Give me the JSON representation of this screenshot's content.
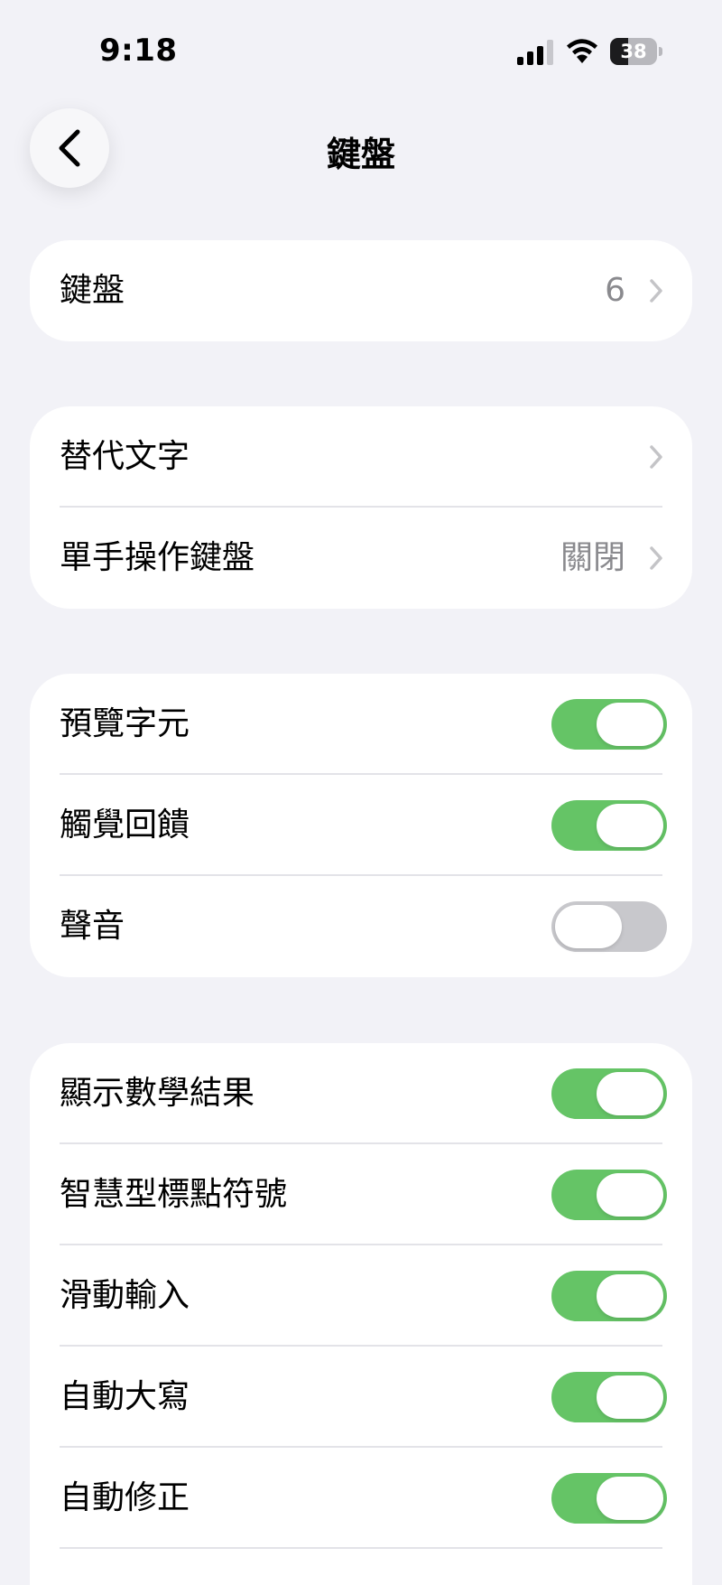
{
  "status_bar": {
    "time": "9:18",
    "battery": "38",
    "battery_level": 0.38
  },
  "nav": {
    "title": "鍵盤",
    "back_icon": "chevron-left-icon"
  },
  "group_keyboards": {
    "label": "鍵盤",
    "value": "6"
  },
  "group_text": {
    "items": [
      {
        "label": "替代文字",
        "value": ""
      },
      {
        "label": "單手操作鍵盤",
        "value": "關閉"
      }
    ]
  },
  "group_feedback": {
    "items": [
      {
        "label": "預覽字元",
        "on": true
      },
      {
        "label": "觸覺回饋",
        "on": true
      },
      {
        "label": "聲音",
        "on": false
      }
    ]
  },
  "group_typing": {
    "items": [
      {
        "label": "顯示數學結果",
        "on": true
      },
      {
        "label": "智慧型標點符號",
        "on": true
      },
      {
        "label": "滑動輸入",
        "on": true
      },
      {
        "label": "自動大寫",
        "on": true
      },
      {
        "label": "自動修正",
        "on": true
      }
    ]
  },
  "colors": {
    "toggle_on": "#65c466",
    "toggle_off": "#c8c8cc",
    "background": "#f2f2f7"
  }
}
